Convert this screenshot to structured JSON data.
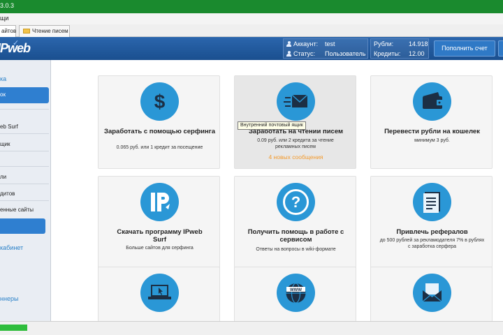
{
  "window": {
    "title_fragment": "3.0.3"
  },
  "menubar": {
    "item_fragment": "щи"
  },
  "tabs": [
    {
      "label": "айтов"
    },
    {
      "label": "Чтение писем"
    }
  ],
  "header": {
    "logo": "IPweb",
    "account_label": "Аккаунт:",
    "account_value": "test",
    "status_label": "Статус:",
    "status_value": "Пользователь",
    "rubles_label": "Рубли:",
    "rubles_value": "14.918",
    "credits_label": "Кредиты:",
    "credits_value": "12.00",
    "topup_button": "Пополнить счет"
  },
  "sidebar": {
    "items": [
      {
        "label": "ка"
      },
      {
        "label": "ок"
      },
      {
        "label": "eb Surf"
      },
      {
        "label": "щик"
      },
      {
        "label": "ли"
      },
      {
        "label": "дитов"
      },
      {
        "label": "енные сайты"
      },
      {
        "label": "кабинет"
      },
      {
        "label": "ннеры"
      }
    ]
  },
  "cards": [
    {
      "icon": "dollar-icon",
      "title": "Заработать с помощью серфинга",
      "subtitle": "0.065 руб. или 1 кредит за посещение",
      "note": ""
    },
    {
      "icon": "envelope-icon",
      "title": "Заработать на чтении писем",
      "subtitle": "0.09 руб. или 2 кредита за чтение рекламных писем",
      "note": "4 новых сообщения"
    },
    {
      "icon": "wallet-icon",
      "title": "Перевести рубли на кошелек",
      "subtitle": "минимум 3 руб.",
      "note": ""
    },
    {
      "icon": "ipweb-icon",
      "title": "Скачать программу IPweb Surf",
      "subtitle": "Больше сайтов для серфинга",
      "note": ""
    },
    {
      "icon": "question-icon",
      "title": "Получить помощь в работе с сервисом",
      "subtitle": "Ответы на вопросы в wiki-формате",
      "note": ""
    },
    {
      "icon": "referral-form-icon",
      "title": "Привлечь рефералов",
      "subtitle": "до 500 рублей за рекламодателя 7% в рублях с заработка серфера",
      "note": ""
    },
    {
      "icon": "laptop-cursor-icon",
      "title": "",
      "subtitle": "",
      "note": ""
    },
    {
      "icon": "www-globe-icon",
      "title": "",
      "subtitle": "",
      "note": ""
    },
    {
      "icon": "open-envelope-icon",
      "title": "",
      "subtitle": "",
      "note": ""
    }
  ],
  "tooltip": "Внутренний почтовый ящик",
  "colors": {
    "titlebar": "#1a8a2e",
    "header": "#1e5799",
    "accent": "#2a97d6",
    "note": "#f39a2d",
    "progress": "#2fbd3c"
  },
  "statusbar": {
    "progress_fraction": 0.054
  }
}
